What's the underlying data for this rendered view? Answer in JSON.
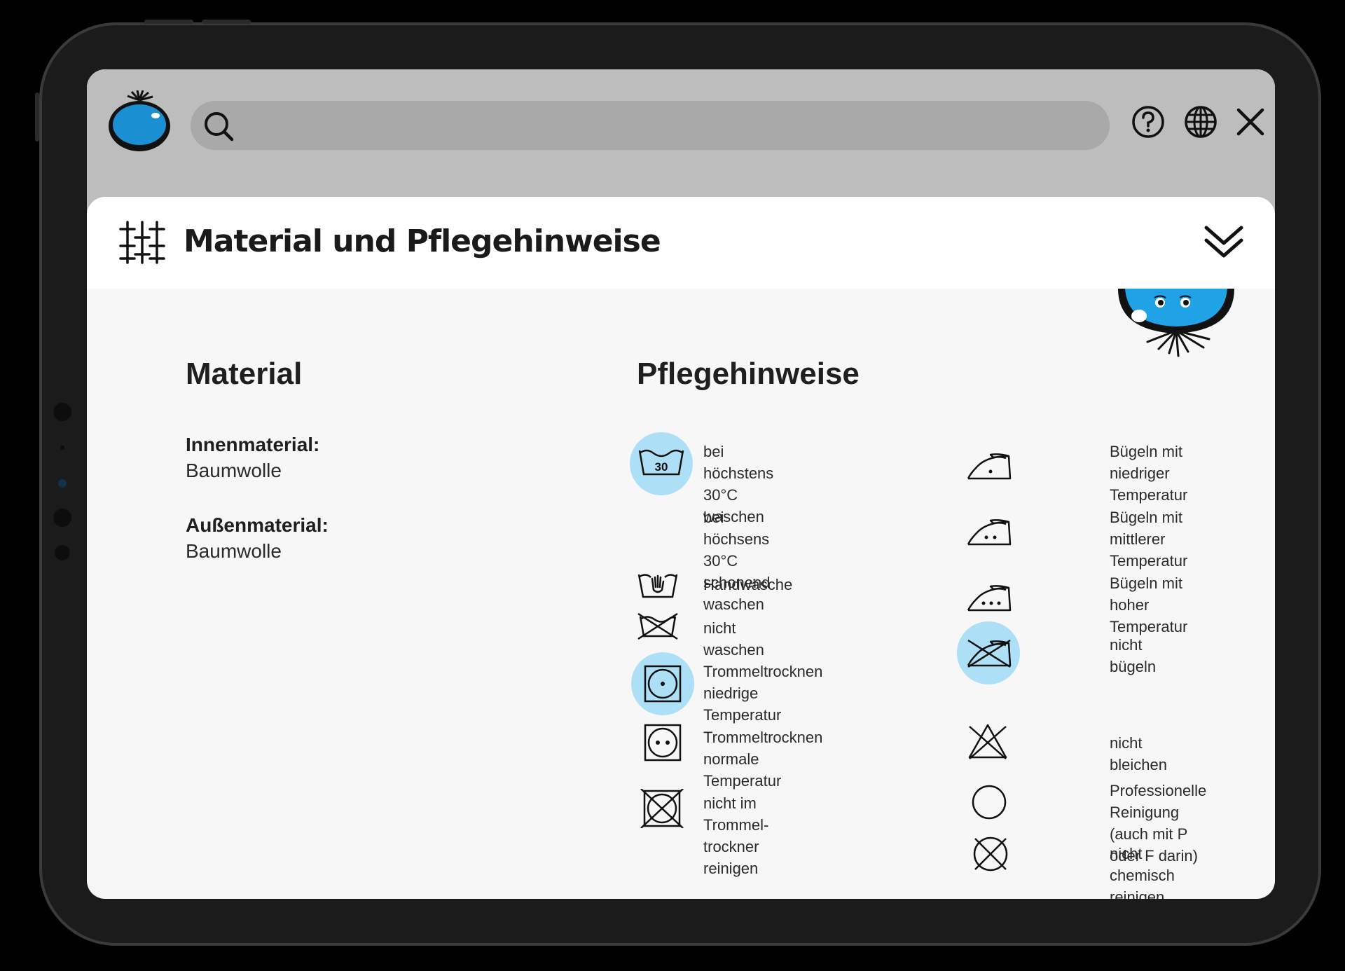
{
  "search": {
    "placeholder": "",
    "value": ""
  },
  "header": {
    "title": "Material und Pflegehinweise",
    "icons": [
      "search-icon",
      "help-icon",
      "globe-icon",
      "close-icon",
      "fabric-icon",
      "chevron-double-down-icon"
    ]
  },
  "material": {
    "heading": "Material",
    "items": [
      {
        "label": "Innenmaterial:",
        "value": "Baumwolle"
      },
      {
        "label": "Außenmaterial:",
        "value": "Baumwolle"
      }
    ]
  },
  "care": {
    "heading": "Pflegehinweise",
    "highlight_color": "#ade0f6",
    "left": [
      {
        "icon": "wash-30-icon",
        "text": "bei höchstens 30°C\nwaschen",
        "highlighted": true,
        "icon_label": "30"
      },
      {
        "icon": "",
        "text": "bei höchsens 30°C schonend\nwaschen",
        "highlighted": false
      },
      {
        "icon": "hand-wash-icon",
        "text": "Handwäsche",
        "highlighted": false
      },
      {
        "icon": "no-wash-icon",
        "text": "nicht waschen",
        "highlighted": false
      },
      {
        "icon": "tumble-dry-low-icon",
        "text": "Trommeltrocknen\nniedrige Temperatur",
        "highlighted": true
      },
      {
        "icon": "tumble-dry-normal-icon",
        "text": "Trommeltrocknen\nnormale Temperatur",
        "highlighted": false
      },
      {
        "icon": "no-tumble-dry-icon",
        "text": "nicht im Trommel-\ntrockner reinigen",
        "highlighted": false
      }
    ],
    "right": [
      {
        "icon": "iron-low-icon",
        "text": "Bügeln mit niedriger\nTemperatur",
        "highlighted": false
      },
      {
        "icon": "iron-medium-icon",
        "text": "Bügeln mit mittlerer\nTemperatur",
        "highlighted": false
      },
      {
        "icon": "iron-high-icon",
        "text": "Bügeln mit hoher\nTemperatur",
        "highlighted": false
      },
      {
        "icon": "no-iron-icon",
        "text": "nicht bügeln",
        "highlighted": true
      },
      {
        "icon": "no-bleach-icon",
        "text": "nicht bleichen",
        "highlighted": false
      },
      {
        "icon": "dry-clean-icon",
        "text": "Professionelle Reinigung\n(auch mit P oder F darin)",
        "highlighted": false
      },
      {
        "icon": "no-dry-clean-icon",
        "text": "nicht chemisch reinigen",
        "highlighted": false
      }
    ]
  },
  "colors": {
    "accent": "#1a8fd1",
    "topbar": "#bdbdbd",
    "search_bg": "#a9a9a9",
    "panel_bg": "#f7f7f7"
  }
}
